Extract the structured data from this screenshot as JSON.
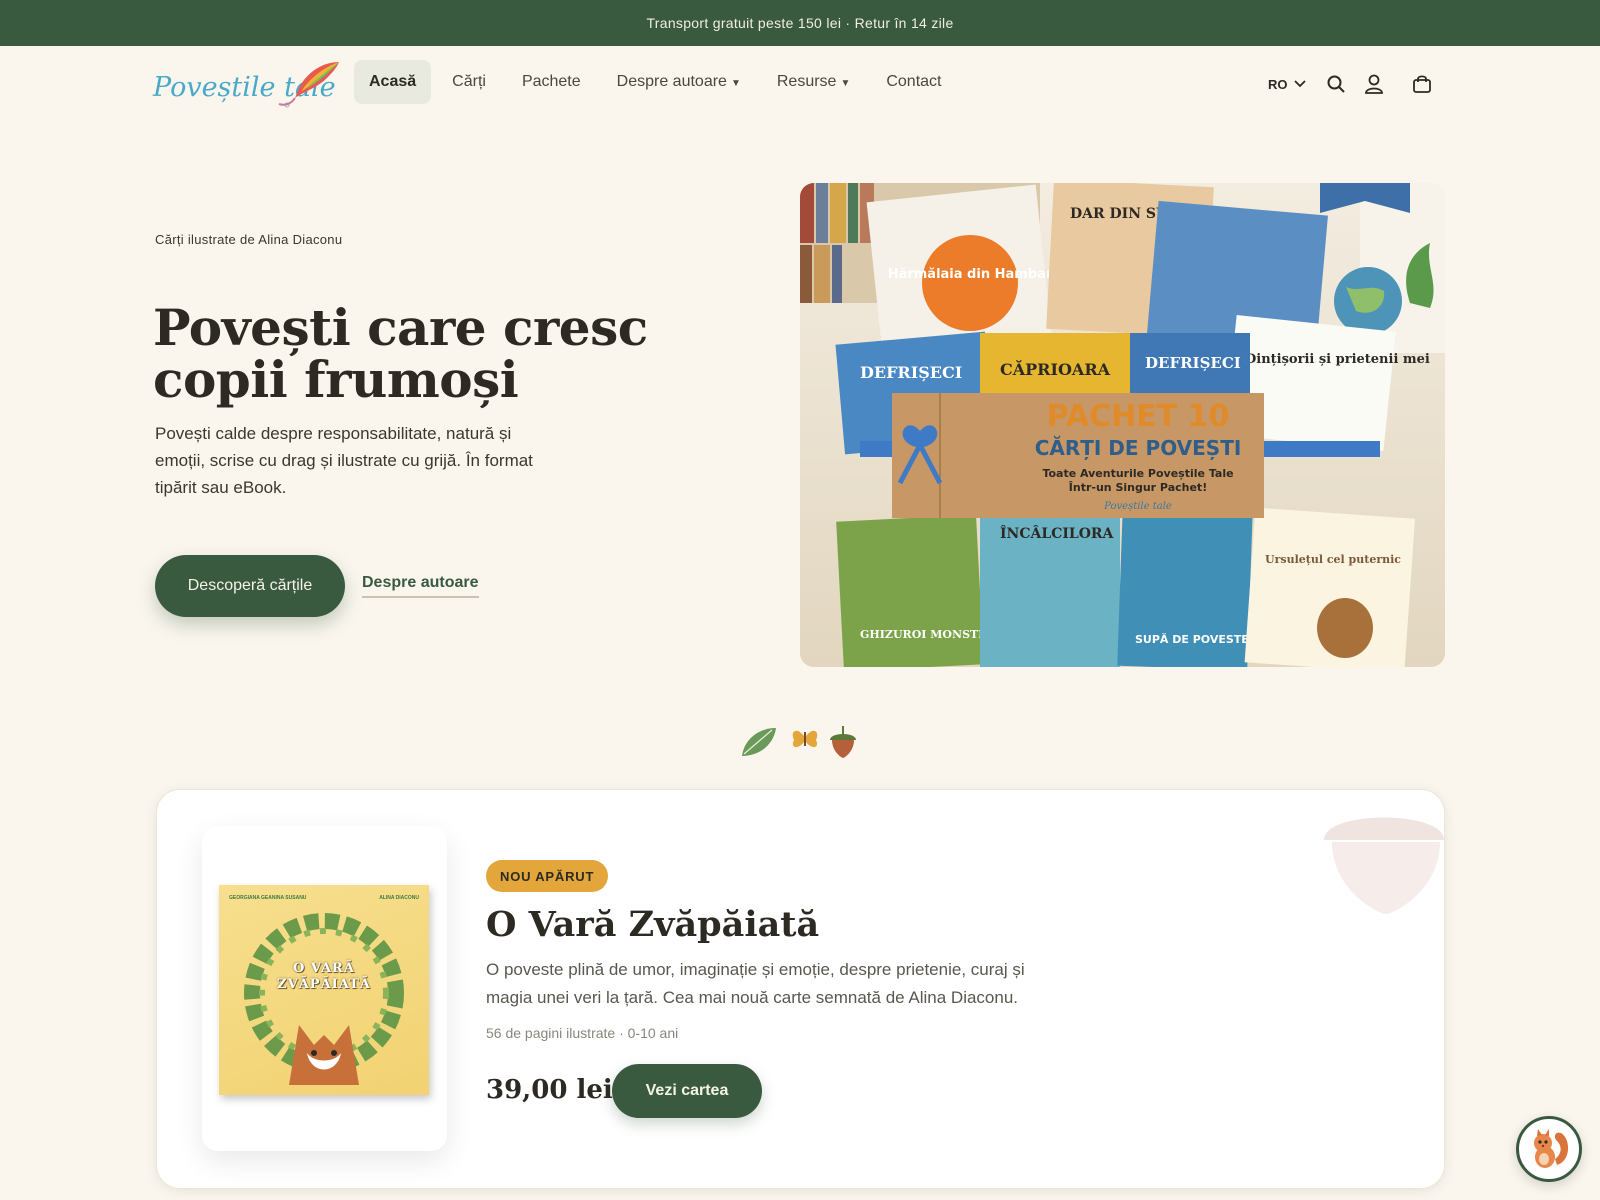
{
  "announcement": "Transport gratuit peste 150 lei · Retur în 14 zile",
  "logo": {
    "text": "Poveștile tale"
  },
  "nav": {
    "items": [
      {
        "label": "Acasă",
        "active": true
      },
      {
        "label": "Cărți"
      },
      {
        "label": "Pachete"
      },
      {
        "label": "Despre autoare"
      },
      {
        "label": "Resurse"
      },
      {
        "label": "Contact"
      }
    ],
    "language": "RO"
  },
  "hero": {
    "eyebrow": "Cărți ilustrate de Alina Diaconu",
    "title": "Povești care cresc copii frumoși",
    "description": "Povești calde despre responsabilitate, natură și emoții, scrise cu drag și ilustrate cu grijă. În format tipărit sau eBook.",
    "primary_cta": "Descoperă cărțile",
    "secondary_cta": "Despre autoare",
    "image": {
      "banner_line1": "PACHET 10",
      "banner_line2": "CĂRȚI DE POVEȘTI",
      "banner_line3": "Toate Aventurile Poveștile Tale",
      "banner_line4": "Într-un Singur Pachet!",
      "banner_logo": "Poveștile tale",
      "books": [
        "Hărmălaia din Hambar",
        "DAR DIN SUFLET",
        "DEFRIȘECI",
        "CĂPRIOARA",
        "DEFRIȘECI",
        "Dințișorii și prietenii mei",
        "GHIZUROI MONSTRUL DE GUMĂ",
        "ÎNCÂLCILORA",
        "SUPĂ DE POVESTE",
        "Ursulețul cel puternic"
      ]
    }
  },
  "featured": {
    "badge": "NOU APĂRUT",
    "title": "O Vară Zvăpăiată",
    "description": "O poveste plină de umor, imaginație și emoție, despre prietenie, curaj și magia unei veri la țară. Cea mai nouă carte semnată de Alina Diaconu.",
    "meta": "56 de pagini ilustrate · 0-10 ani",
    "price": "39,00 lei",
    "cta": "Vezi cartea",
    "cover": {
      "title_line1": "O VARĂ",
      "title_line2": "ZVĂPĂIATĂ",
      "illustrator": "GEORGIANA GEANINA SUSANU",
      "author": "ALINA DIACONU"
    }
  },
  "colors": {
    "brand_green": "#3a5a40",
    "background": "#faf6ee",
    "badge": "#e2a63a"
  }
}
